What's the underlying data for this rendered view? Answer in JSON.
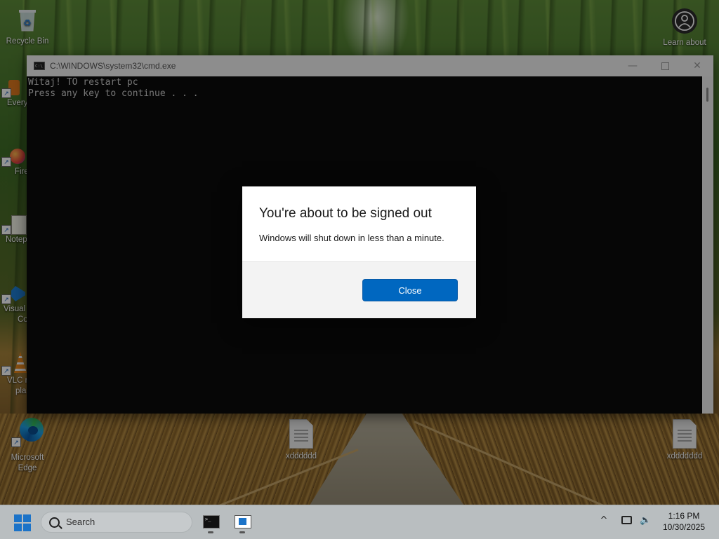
{
  "desktop": {
    "icons": [
      {
        "label": "Recycle Bin"
      },
      {
        "label": "Learn about"
      },
      {
        "label": "Every"
      },
      {
        "label": "Fire"
      },
      {
        "label": "Notep"
      },
      {
        "label": "Visual"
      },
      {
        "label": "Co"
      },
      {
        "label": "VLC r"
      },
      {
        "label": "pla"
      },
      {
        "label": "Microsoft Edge"
      },
      {
        "label": "xdddddd"
      },
      {
        "label": "xddddddd"
      }
    ]
  },
  "cmd": {
    "title": "C:\\WINDOWS\\system32\\cmd.exe",
    "line1": "Witaj! TO restart pc",
    "line2": "Press any key to continue . . .",
    "minimize": "—",
    "close": "✕"
  },
  "dialog": {
    "title": "You're about to be signed out",
    "message": "Windows will shut down in less than a minute.",
    "close_label": "Close"
  },
  "taskbar": {
    "search_placeholder": "Search",
    "chevron": "^",
    "time": "1:16 PM",
    "date": "10/30/2025"
  },
  "colors": {
    "accent": "#0067c0",
    "console_bg": "#0c0c0c",
    "console_text": "#cccccc"
  }
}
